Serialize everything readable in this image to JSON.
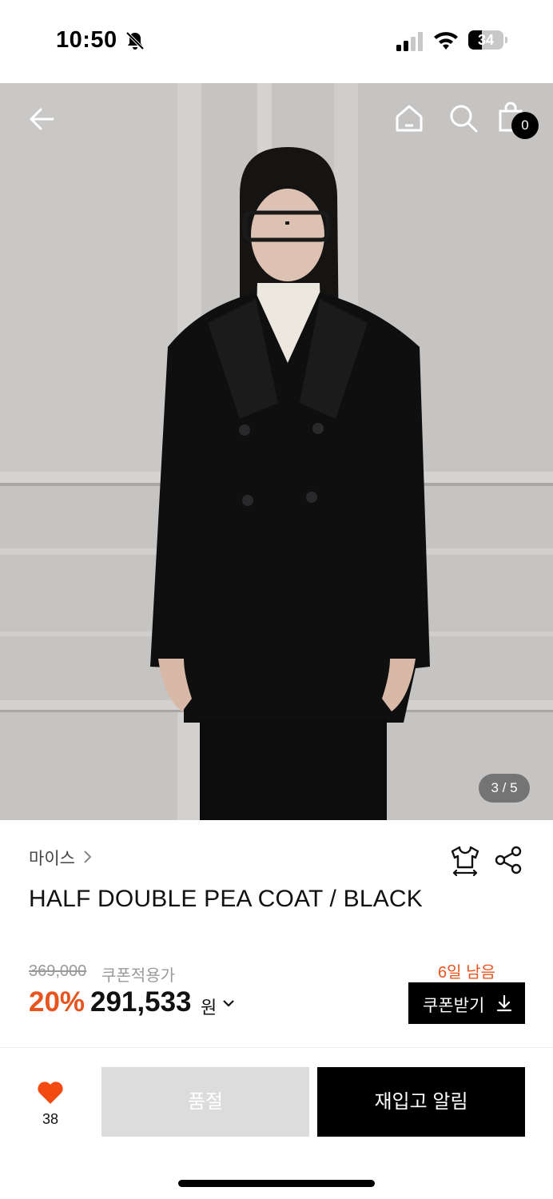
{
  "status_bar": {
    "time": "10:50",
    "battery": "34",
    "icons": [
      "bell-slash-icon",
      "cellular-signal-icon",
      "wifi-icon",
      "battery-icon"
    ]
  },
  "header": {
    "icons": [
      "back-arrow-icon",
      "home-icon",
      "search-icon",
      "shopping-bag-icon"
    ],
    "cart_count": "0"
  },
  "gallery": {
    "counter": "3 / 5"
  },
  "product": {
    "brand": "마이스",
    "name": "HALF DOUBLE PEA COAT / BLACK",
    "original_price": "369,000",
    "price_note": "쿠폰적용가",
    "discount": "20%",
    "price": "291,533",
    "currency": "원"
  },
  "coupon": {
    "days_left": "6일 남음",
    "button_label": "쿠폰받기"
  },
  "bottom_bar": {
    "like_count": "38",
    "soldout_label": "품절",
    "restock_label": "재입고 알림"
  },
  "colors": {
    "accent": "#e8541e",
    "black": "#000000",
    "disabled": "#dcdcdc"
  }
}
